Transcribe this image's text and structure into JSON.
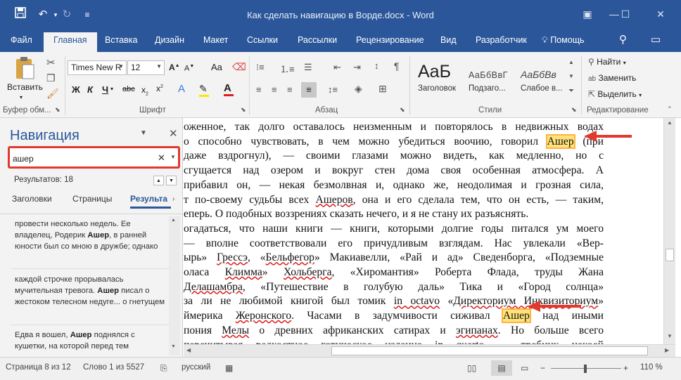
{
  "window": {
    "title": "Как сделать навигацию в Ворде.docx - Word"
  },
  "tabs": [
    "Файл",
    "Главная",
    "Вставка",
    "Дизайн",
    "Макет",
    "Ссылки",
    "Рассылки",
    "Рецензирование",
    "Вид",
    "Разработчик"
  ],
  "tell_me": "Помощь",
  "ribbon": {
    "clipboard": {
      "paste": "Вставить",
      "label": "Буфер обм..."
    },
    "font": {
      "family": "Times New R",
      "size": "12",
      "label": "Шрифт",
      "bold": "Ж",
      "italic": "К",
      "underline": "Ч"
    },
    "paragraph": {
      "label": "Абзац"
    },
    "styles": {
      "label": "Стили",
      "items": [
        {
          "preview": "AaБ",
          "name": "Заголовок"
        },
        {
          "preview": "AaБбВвГ",
          "name": "Подзаго..."
        },
        {
          "preview": "AaБбВв",
          "name": "Слабое в..."
        }
      ]
    },
    "editing": {
      "find": "Найти",
      "replace": "Заменить",
      "select": "Выделить",
      "label": "Редактирование"
    }
  },
  "nav": {
    "title": "Навигация",
    "search_value": "ашер",
    "results_count": "Результатов: 18",
    "tabs": [
      "Заголовки",
      "Страницы",
      "Результа"
    ],
    "results": [
      {
        "before": "провести несколько недель. Ее владелец, Родерик ",
        "match": "Ашер",
        "after": ", в ранней юности был со мною в дружбе; однако"
      },
      {
        "before": "каждой строчке прорывалась мучительная тревога. ",
        "match": "Ашер",
        "after": " писал о жестоком телесном недуге... о гнетущем"
      },
      {
        "before": "Едва я вошел, ",
        "match": "Ашер",
        "after": " поднялся с кушетки, на которой перед тем"
      }
    ]
  },
  "document": {
    "lines": [
      [
        "оженное, так долго оставалось неизменным и повторялось в недвижных водах"
      ],
      [
        "о способно чувствовать, в чем можно убедиться воочию, говорил ",
        {
          "hl": "Ашер"
        },
        " (при"
      ],
      [
        "даже вздрогнул), — своими глазами можно видеть, как медленно, но с"
      ],
      [
        " сгущается над озером и вокруг стен дома своя особенная атмосфера. А"
      ],
      [
        " прибавил он, — некая безмолвная и, однако же, неодолимая и грозная сила,"
      ],
      [
        "т по-своему судьбы всех ",
        {
          "u": "Ашеров"
        },
        ", она и его сделала тем, что он есть, — таким,"
      ],
      [
        "еперь. О подобных воззрениях сказать нечего, и я не стану их разъяснять."
      ],
      [
        "огадаться, что наши книги — книги, которыми долгие годы питался ум моего"
      ],
      [
        " — вполне соответствовали его причудливым взглядам. Нас увлекали «Вер-"
      ],
      [
        "ырь» ",
        {
          "u": "Грессэ"
        },
        ", «",
        {
          "u": "Бельфегор"
        },
        "» Макиавелли, «Рай и ад» Сведенборга, «Подземные"
      ],
      [
        "оласа ",
        {
          "u": "Климма"
        },
        "» ",
        {
          "u": "Хольберга"
        },
        ", «Хиромантия» Роберта Флада, труды Жана"
      ],
      [
        {
          "u": "Делашамбра"
        },
        ", «Путешествие в голубую даль» Тика и «Город солнца»"
      ],
      [
        "за ли не любимой книгой был томик ",
        {
          "u": "in octavo"
        },
        " «",
        {
          "u": "Директориум Инквизиториум"
        },
        "»"
      ],
      [
        "ймерика ",
        {
          "u": "Жеронского"
        },
        ". Часами в задумчивости сиживал ",
        {
          "hl": "Ашер"
        },
        " над иными"
      ],
      [
        "пония ",
        {
          "u": "Мелы"
        },
        " о древних африканских сатирах и ",
        {
          "u": "эгипанах"
        },
        ". Но больше всего"
      ],
      [
        " перечитывая редкостное готическое издание ",
        {
          "u": "in quarto"
        },
        " — требник некоей"
      ]
    ]
  },
  "status": {
    "page": "Страница 8 из 12",
    "words": "Слово 1 из 5527",
    "language": "русский",
    "zoom": "110 %"
  },
  "colors": {
    "brand": "#2b579a",
    "highlight": "#ffe37a",
    "annotation": "#e03a2e"
  }
}
